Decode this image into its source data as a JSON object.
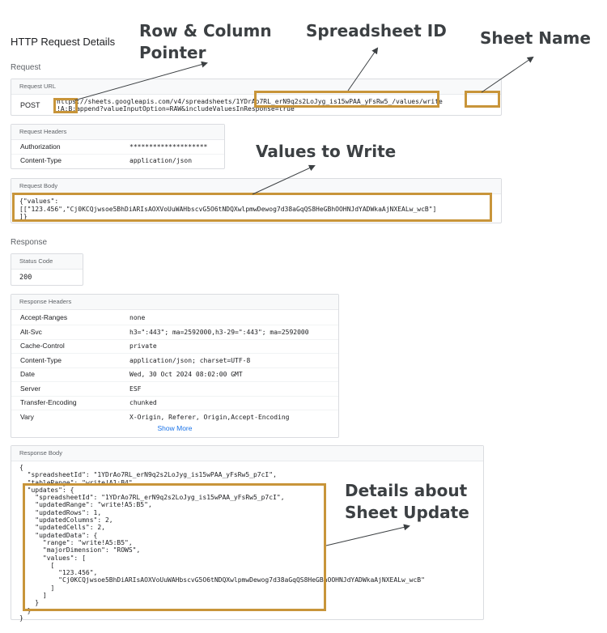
{
  "page_title": "HTTP Request Details",
  "request": {
    "section_label": "Request",
    "url_panel": {
      "header": "Request URL",
      "method": "POST",
      "url_line1": "https://sheets.googleapis.com/v4/spreadsheets/1YDrAo7RL_erN9q2s2LoJyg_is15wPAA_yFsRw5_/values/write",
      "url_line2": "!A:B:append?valueInputOption=RAW&includeValuesInResponse=true"
    },
    "headers_panel": {
      "header": "Request Headers",
      "rows": [
        {
          "key": "Authorization",
          "value": "********************"
        },
        {
          "key": "Content-Type",
          "value": "application/json"
        }
      ]
    },
    "body_panel": {
      "header": "Request Body",
      "body": "{\"values\":\n[[\"123.456\",\"Cj0KCQjwsoe5BhDiARIsAOXVoUuWAHbscvG5O6tNDQXwlpmwDewog7d38aGqQS8HeGBhOOHNJdYADWkaAjNXEALw_wcB\"]\n]}"
    }
  },
  "response": {
    "section_label": "Response",
    "status_panel": {
      "header": "Status Code",
      "value": "200"
    },
    "headers_panel": {
      "header": "Response Headers",
      "rows": [
        {
          "key": "Accept-Ranges",
          "value": "none"
        },
        {
          "key": "Alt-Svc",
          "value": "h3=\":443\"; ma=2592000,h3-29=\":443\"; ma=2592000"
        },
        {
          "key": "Cache-Control",
          "value": "private"
        },
        {
          "key": "Content-Type",
          "value": "application/json; charset=UTF-8"
        },
        {
          "key": "Date",
          "value": "Wed, 30 Oct 2024 08:02:00 GMT"
        },
        {
          "key": "Server",
          "value": "ESF"
        },
        {
          "key": "Transfer-Encoding",
          "value": "chunked"
        },
        {
          "key": "Vary",
          "value": "X-Origin, Referer, Origin,Accept-Encoding"
        }
      ],
      "show_more": "Show More"
    },
    "body_panel": {
      "header": "Response Body",
      "body": "{\n  \"spreadsheetId\": \"1YDrAo7RL_erN9q2s2LoJyg_is15wPAA_yFsRw5_p7cI\",\n  \"tableRange\": \"write!A1:B4\",\n  \"updates\": {\n    \"spreadsheetId\": \"1YDrAo7RL_erN9q2s2LoJyg_is15wPAA_yFsRw5_p7cI\",\n    \"updatedRange\": \"write!A5:B5\",\n    \"updatedRows\": 1,\n    \"updatedColumns\": 2,\n    \"updatedCells\": 2,\n    \"updatedData\": {\n      \"range\": \"write!A5:B5\",\n      \"majorDimension\": \"ROWS\",\n      \"values\": [\n        [\n          \"123.456\",\n          \"Cj0KCQjwsoe5BhDiARIsAOXVoUuWAHbscvG5O6tNDQXwlpmwDewog7d38aGqQS8HeGBhOOHNJdYADWkaAjNXEALw_wcB\"\n        ]\n      ]\n    }\n  }\n}"
    }
  },
  "annotations": {
    "row_column_pointer": "Row & Column\nPointer",
    "spreadsheet_id": "Spreadsheet ID",
    "sheet_name": "Sheet Name",
    "values_to_write": "Values to Write",
    "details_update": "Details about\nSheet Update"
  },
  "colors": {
    "highlight": "#c8953a",
    "annotation_text": "#3c4043",
    "link": "#1a73e8"
  }
}
